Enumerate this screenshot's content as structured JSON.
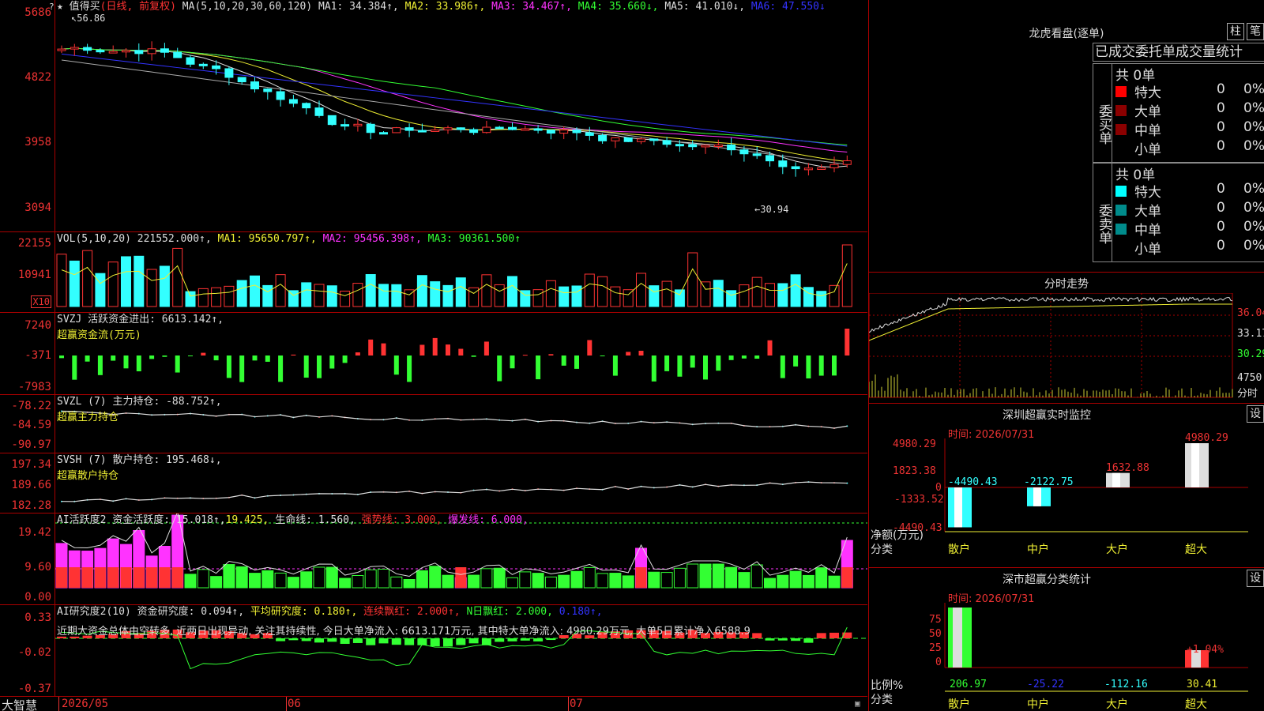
{
  "main": {
    "y_labels": [
      "5686",
      "4822",
      "3958",
      "3094"
    ],
    "title": "★ 值得买",
    "period": "(日线, 前复权)",
    "ma_param": "MA(5,10,20,30,60,120)",
    "ma1": "MA1: 34.384↑,",
    "ma2": "MA2: 33.986↑,",
    "ma3": "MA3: 34.467↑,",
    "ma4": "MA4: 35.660↓,",
    "ma5": "MA5: 41.010↓,",
    "ma6": "MA6: 47.550↓",
    "high_mark": "56.86",
    "low_mark": "←30.94"
  },
  "vol": {
    "y_labels": [
      "22155",
      "10941"
    ],
    "unit": "X10",
    "title": "VOL(5,10,20)",
    "value": "221552.000↑,",
    "ma1": "MA1: 95650.797↑,",
    "ma2": "MA2: 95456.398↑,",
    "ma3": "MA3: 90361.500↑"
  },
  "svzj": {
    "y_labels": [
      "7240",
      "-371",
      "-7983"
    ],
    "title": "SVZJ  活跃资金进出: 6613.142↑,",
    "sub": "超赢资金流(万元)"
  },
  "svzl": {
    "y_labels": [
      "-78.22",
      "-84.59",
      "-90.97"
    ],
    "title": "SVZL (7) 主力持仓: -88.752↑,",
    "sub": "超赢主力持仓"
  },
  "svsh": {
    "y_labels": [
      "197.34",
      "189.66",
      "182.28"
    ],
    "title": "SVSH (7) 散户持仓: 195.468↓,",
    "sub": "超赢散户持仓"
  },
  "ai_act": {
    "y_labels": [
      "19.42",
      "9.60",
      "0.00"
    ],
    "title": "AI活跃度2 资金活跃度: 15.018↑,",
    "v2": "19.425,",
    "life": "生命线: 1.560,",
    "strong": "强势线: 3.000,",
    "burst": "爆发线: 6.000,"
  },
  "ai_res": {
    "y_labels": [
      "0.33",
      "-0.02",
      "-0.37"
    ],
    "title": "AI研究度2(10) 资金研究度: 0.094↑,",
    "avg": "平均研究度: 0.180↑,",
    "cont": "连续飘红: 2.000↑,",
    "nday": "N日飘红: 2.000,",
    "last": "0.180↑,",
    "comment": "近期大资金总体由空转多, 近两日出现异动, 关注其持续性, 今日大单净流入: 6613.171万元, 其中特大单净流入: 4980.29万元, 大单5日累计净入6588.9"
  },
  "xaxis": {
    "brand": "大智慧",
    "months": [
      "2026/05",
      "06",
      "07"
    ]
  },
  "lhb": {
    "title": "龙虎看盘(逐单)",
    "btn_bar": "柱",
    "btn_pen": "笔",
    "tabs": [
      "已成交",
      "委托单",
      "成交量统计"
    ],
    "buy_label": "委买单",
    "sell_label": "委卖单",
    "buy_total": "共 0单",
    "sell_total": "共 0单",
    "buy_rows": [
      {
        "name": "特大",
        "count": "0",
        "pct": "0%",
        "color": "#ff0000"
      },
      {
        "name": "大单",
        "count": "0",
        "pct": "0%",
        "color": "#8b0000"
      },
      {
        "name": "中单",
        "count": "0",
        "pct": "0%",
        "color": "#8b0000"
      },
      {
        "name": "小单",
        "count": "0",
        "pct": "0%",
        "color": "#000000"
      }
    ],
    "sell_rows": [
      {
        "name": "特大",
        "count": "0",
        "pct": "0%",
        "color": "#00ffff"
      },
      {
        "name": "大单",
        "count": "0",
        "pct": "0%",
        "color": "#008b8b"
      },
      {
        "name": "中单",
        "count": "0",
        "pct": "0%",
        "color": "#008b8b"
      },
      {
        "name": "小单",
        "count": "0",
        "pct": "0%",
        "color": "#000000"
      }
    ]
  },
  "intraday": {
    "title": "分时走势",
    "prices": [
      "36.04",
      "33.17",
      "30.29"
    ],
    "vol": "4750",
    "unit": "分时"
  },
  "sz_monitor": {
    "title": "深圳超赢实时监控",
    "btn": "设",
    "time": "时间: 2026/07/31",
    "y_labels": [
      "4980.29",
      "1823.38",
      "0",
      "-1333.52",
      "-4490.43"
    ],
    "axis_label": "净额(万元)",
    "cat_label": "分类",
    "categories": [
      "散户",
      "中户",
      "大户",
      "超大"
    ],
    "values": [
      "-4490.43",
      "-2122.75",
      "1632.88",
      "4980.29"
    ]
  },
  "sz_stats": {
    "title": "深市超赢分类统计",
    "btn": "设",
    "time": "时间: 2026/07/31",
    "y_labels": [
      "75",
      "50",
      "25",
      "0"
    ],
    "axis_label": "比例%",
    "cat_label": "分类",
    "categories": [
      "散户",
      "中户",
      "大户",
      "超大"
    ],
    "values": [
      "206.97",
      "-25.22",
      "-112.16",
      "30.41"
    ],
    "pct_note": "+1.04%"
  },
  "chart_data": {
    "type": "candlestick",
    "y_range": [
      30.94,
      56.86
    ],
    "volume_unit": "X10"
  }
}
